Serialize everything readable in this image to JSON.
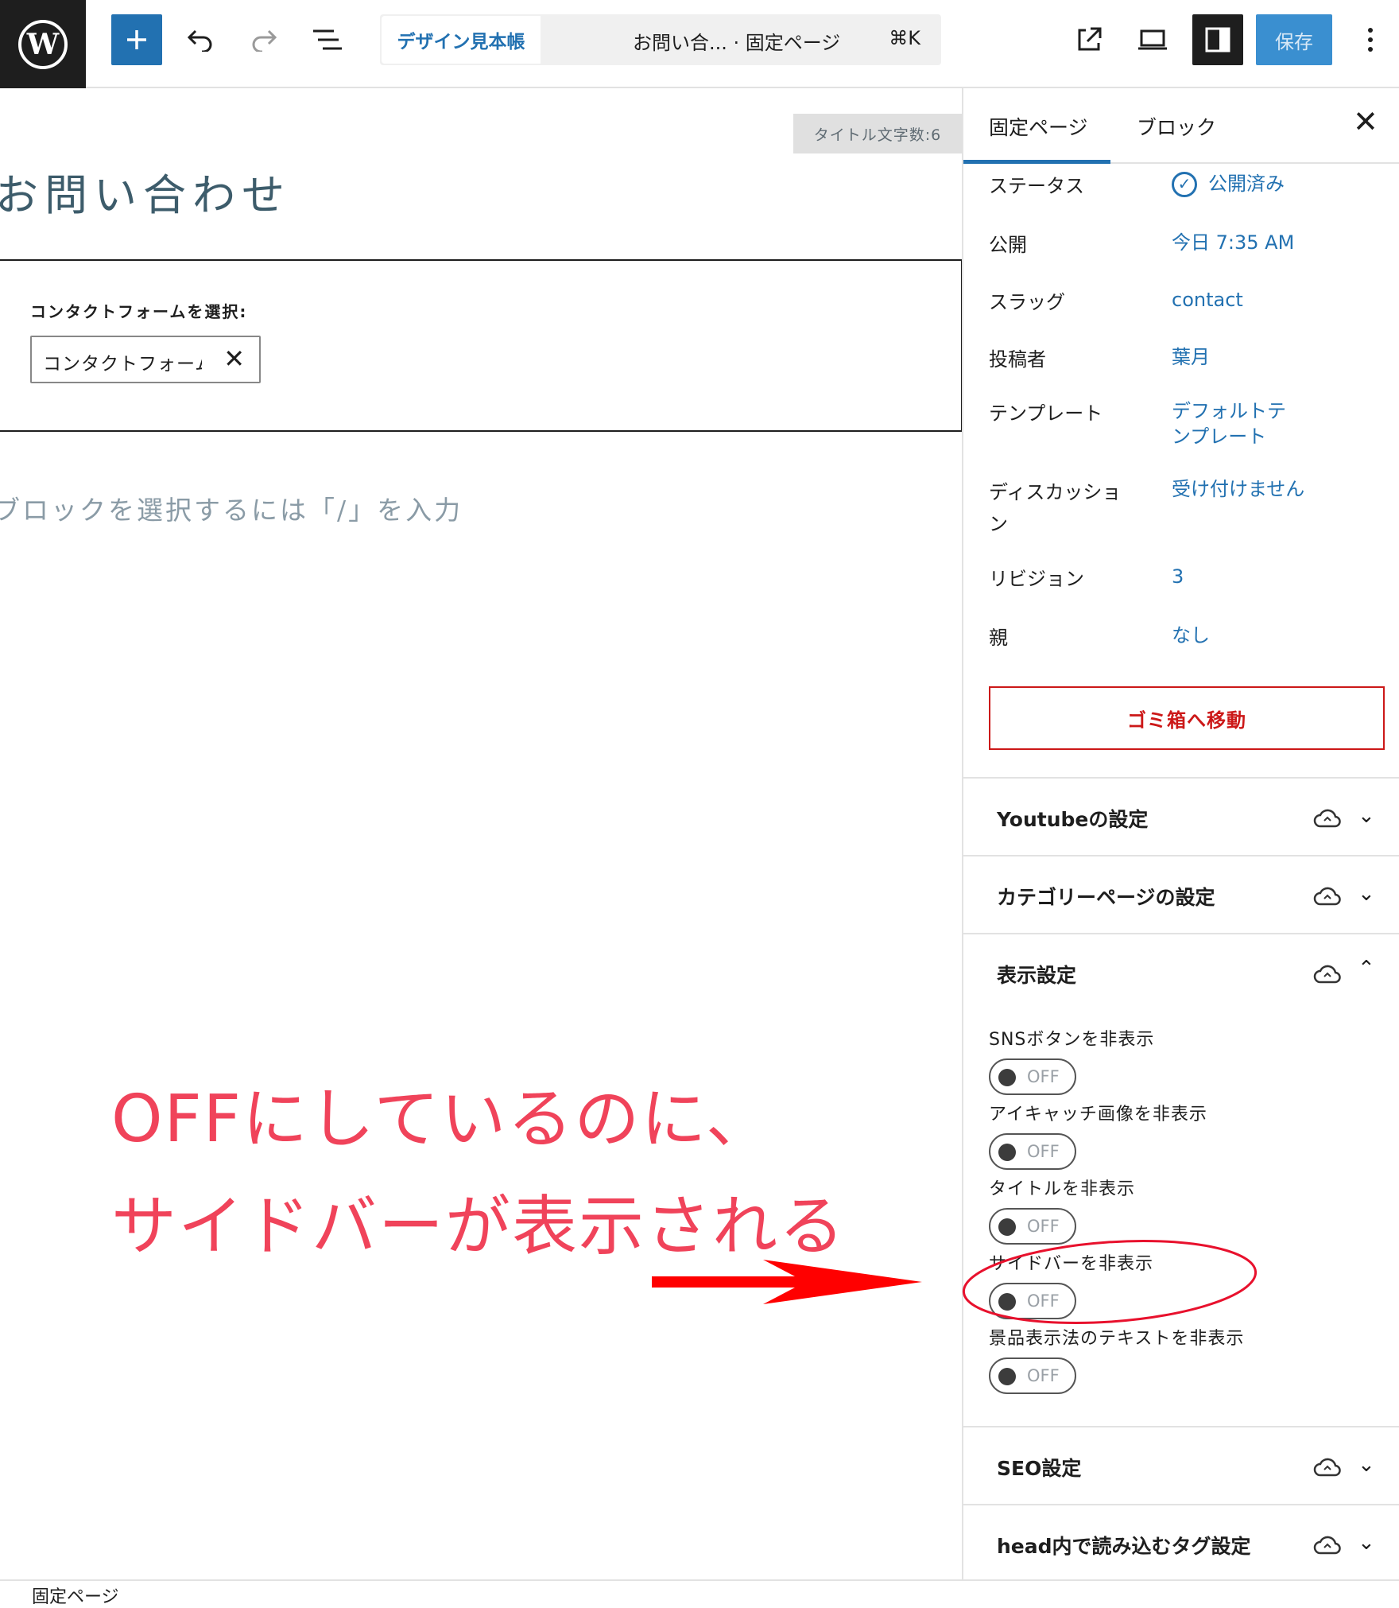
{
  "topbar": {
    "back_label": "デザイン見本帳",
    "doc_title": "お問い合...",
    "doc_type": "· 固定ページ",
    "shortcut": "⌘K",
    "save_label": "保存"
  },
  "canvas": {
    "char_count": "タイトル文字数:6",
    "page_title": "お問い合わせ",
    "form_label": "コンタクトフォームを選択:",
    "form_value": "コンタクトフォーム",
    "placeholder": "ブロックを選択するには「/」を入力"
  },
  "sidebar": {
    "tabs": [
      "固定ページ",
      "ブロック"
    ],
    "rows": [
      {
        "label": "ステータス",
        "value": "公開済み"
      },
      {
        "label": "公開",
        "value": "今日 7:35 AM"
      },
      {
        "label": "スラッグ",
        "value": "contact"
      },
      {
        "label": "投稿者",
        "value": "葉月"
      },
      {
        "label": "テンプレート",
        "value": "デフォルトテンプレート"
      },
      {
        "label": "ディスカッション",
        "value": "受け付けません"
      },
      {
        "label": "リビジョン",
        "value": "3"
      },
      {
        "label": "親",
        "value": "なし"
      }
    ],
    "trash_label": "ゴミ箱へ移動",
    "panels": {
      "youtube": "Youtubeの設定",
      "category": "カテゴリーページの設定",
      "display": "表示設定",
      "seo": "SEO設定",
      "head": "head内で読み込むタグ設定"
    },
    "toggles": [
      {
        "label": "SNSボタンを非表示",
        "state": "OFF"
      },
      {
        "label": "アイキャッチ画像を非表示",
        "state": "OFF"
      },
      {
        "label": "タイトルを非表示",
        "state": "OFF"
      },
      {
        "label": "サイドバーを非表示",
        "state": "OFF"
      },
      {
        "label": "景品表示法のテキストを非表示",
        "state": "OFF"
      }
    ]
  },
  "annotation": {
    "line1": "OFFにしているのに、",
    "line2": "サイドバーが表示される",
    "color": "#f0435a"
  },
  "footer": {
    "label": "固定ページ"
  },
  "colors": {
    "accent": "#2271b1",
    "danger": "#cc1818",
    "dark": "#1e1e1e"
  }
}
